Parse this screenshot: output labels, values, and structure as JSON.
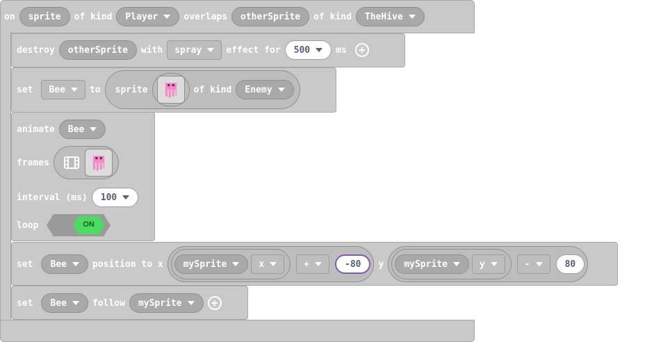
{
  "event": {
    "on": "on",
    "sprite": "sprite",
    "of_kind_1": "of kind",
    "kind1": "Player",
    "overlaps": "overlaps",
    "other": "otherSprite",
    "of_kind_2": "of kind",
    "kind2": "TheHive"
  },
  "destroy": {
    "label": "destroy",
    "target": "otherSprite",
    "with": "with",
    "effect": "spray",
    "effect_for": "effect for",
    "duration": "500",
    "unit": "ms"
  },
  "set_sprite": {
    "set": "set",
    "var": "Bee",
    "to": "to",
    "sprite": "sprite",
    "of_kind": "of kind",
    "kind": "Enemy"
  },
  "animate": {
    "label": "animate",
    "var": "Bee",
    "frames": "frames",
    "interval": "interval (ms)",
    "interval_value": "100",
    "loop": "loop",
    "loop_state": "ON"
  },
  "position": {
    "set": "set",
    "var": "Bee",
    "label": "position to x",
    "x_sprite": "mySprite",
    "x_prop": "x",
    "x_op": "+",
    "x_val": "-80",
    "y": "y",
    "y_sprite": "mySprite",
    "y_prop": "y",
    "y_op": "-",
    "y_val": "80"
  },
  "follow": {
    "set": "set",
    "var": "Bee",
    "follow": "follow",
    "target": "mySprite"
  },
  "colors": {
    "block": "#c9c9c9",
    "toggle_on": "#4cd964",
    "text": "#ffffff"
  }
}
